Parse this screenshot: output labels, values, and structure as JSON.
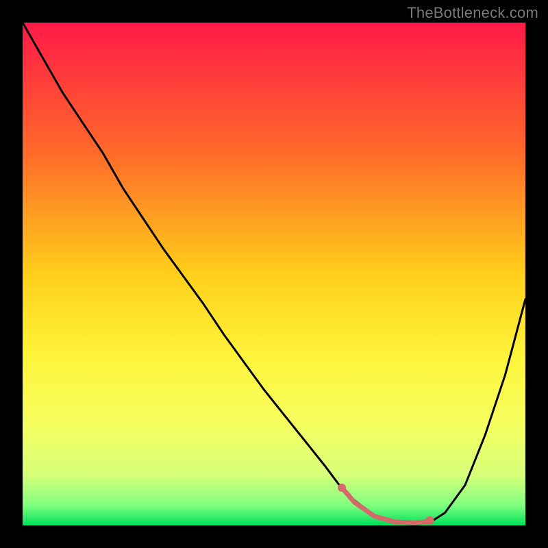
{
  "watermark": "TheBottleneck.com",
  "chart_data": {
    "type": "line",
    "title": "",
    "xlabel": "",
    "ylabel": "",
    "xlim": [
      0,
      100
    ],
    "ylim": [
      0,
      100
    ],
    "gradient_stops": [
      {
        "offset": 0,
        "color": "#ff1a47"
      },
      {
        "offset": 26,
        "color": "#ff6a2a"
      },
      {
        "offset": 50,
        "color": "#ffcf1a"
      },
      {
        "offset": 66,
        "color": "#fff33a"
      },
      {
        "offset": 80,
        "color": "#f6ff60"
      },
      {
        "offset": 90,
        "color": "#d6ff7a"
      },
      {
        "offset": 96,
        "color": "#80ff80"
      },
      {
        "offset": 100,
        "color": "#00e05a"
      }
    ],
    "curve": {
      "x": [
        0,
        4,
        8,
        12,
        16,
        20,
        24,
        28,
        32,
        36,
        40,
        44,
        48,
        52,
        56,
        60,
        63,
        66,
        70,
        74,
        78,
        81,
        84,
        88,
        92,
        96,
        100
      ],
      "y": [
        100,
        93,
        86,
        80,
        74,
        67,
        61,
        55,
        49.5,
        44,
        38,
        32.5,
        27,
        22,
        17,
        12,
        8,
        5,
        2,
        0.7,
        0.4,
        0.6,
        2.5,
        8,
        18,
        30,
        45
      ]
    },
    "highlight_segment": {
      "x": [
        63.5,
        66,
        70,
        74,
        78,
        81
      ],
      "y": [
        7.5,
        4.6,
        1.8,
        0.7,
        0.5,
        0.8
      ],
      "color": "#d46a6a",
      "width": 7
    },
    "highlight_dots": [
      {
        "x": 63.5,
        "y": 7.5,
        "r": 6,
        "color": "#d46a6a"
      },
      {
        "x": 81,
        "y": 1.0,
        "r": 6,
        "color": "#d46a6a"
      }
    ]
  }
}
